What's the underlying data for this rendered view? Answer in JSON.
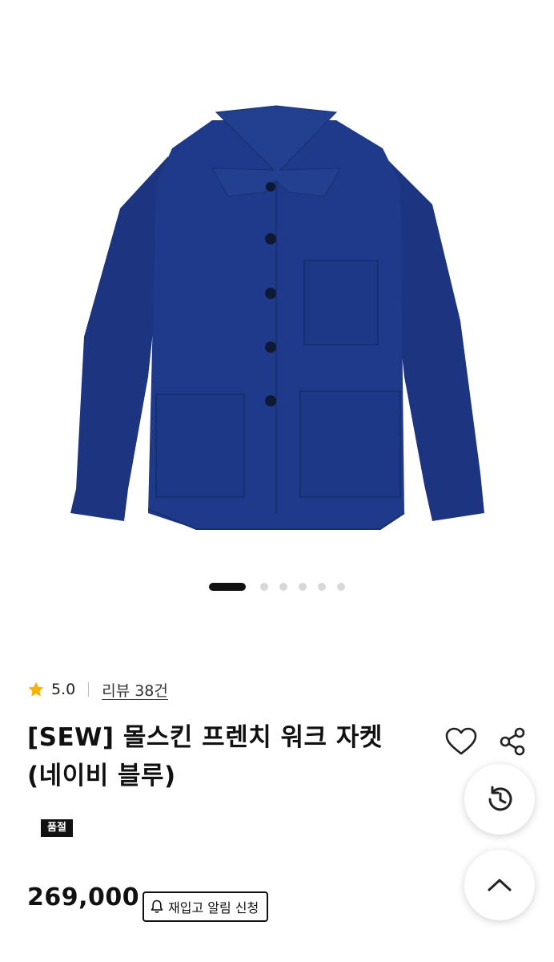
{
  "product": {
    "image_alt": "navy moleskin french work jacket",
    "rating": "5.0",
    "review_label": "리뷰 38건",
    "title_line1": "[SEW] 몰스킨 프렌치 워크 자켓",
    "title_line2": "(네이비 블루)",
    "status_badge": "품절",
    "price": "269,000",
    "restock_label": "재입고 알림 신청"
  },
  "gallery": {
    "total_slides": 6,
    "active_index": 0
  },
  "colors": {
    "jacket": "#1f3a8a",
    "star": "#f5b301",
    "badge_bg": "#111111"
  },
  "icons": {
    "wishlist": "heart-icon",
    "share": "share-icon",
    "history": "history-icon",
    "scroll_top": "chevron-up-icon",
    "restock": "bell-icon"
  }
}
